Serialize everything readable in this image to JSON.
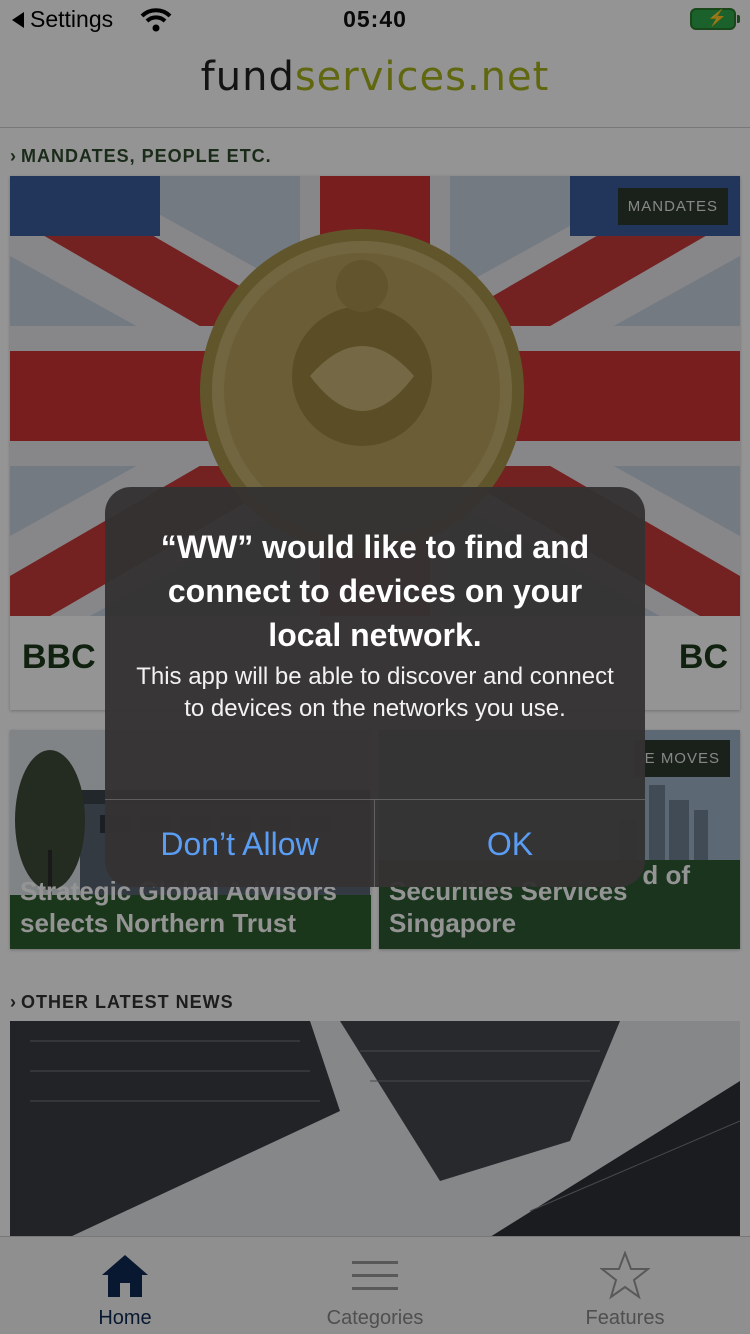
{
  "status_bar": {
    "back_label": "Settings",
    "time": "05:40"
  },
  "header": {
    "logo_part1": "fund",
    "logo_part2": "services.net"
  },
  "sections": {
    "mandates_title": "MANDATES, PEOPLE ETC.",
    "other_news_title": "OTHER LATEST NEWS"
  },
  "hero": {
    "badge": "MANDATES",
    "title_left": "BBC",
    "title_right": "BC"
  },
  "cards": [
    {
      "caption": "Strategic Global Advisors selects Northern Trust"
    },
    {
      "badge": "E MOVES",
      "caption_top": "d of",
      "caption": "Securities Services Singapore"
    }
  ],
  "alert": {
    "title": "“WW” would like to find and connect to devices on your local network.",
    "message": "This app will be able to discover and connect to devices on the networks you use.",
    "deny_label": "Don’t Allow",
    "ok_label": "OK"
  },
  "tabbar": {
    "items": [
      {
        "label": "Home",
        "icon": "home-icon"
      },
      {
        "label": "Categories",
        "icon": "menu-icon"
      },
      {
        "label": "Features",
        "icon": "star-icon"
      }
    ]
  },
  "colors": {
    "accent_green": "#a5b11a",
    "alert_button_blue": "#5a9df5",
    "tab_active": "#0f2a55"
  }
}
